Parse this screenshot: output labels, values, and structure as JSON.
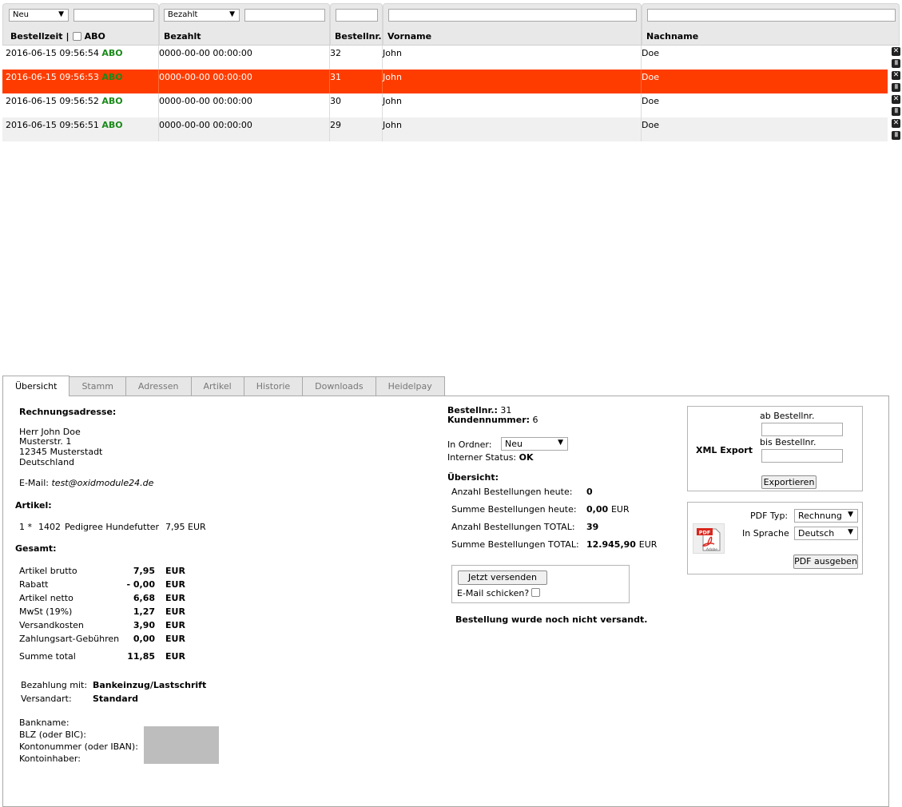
{
  "list": {
    "filters": {
      "folder_value": "Neu",
      "paid_value": "Bezahlt"
    },
    "headers": {
      "time": "Bestellzeit",
      "separator": "|",
      "abo": "ABO",
      "paid": "Bezahlt",
      "ordernr": "Bestellnr.",
      "firstname": "Vorname",
      "lastname": "Nachname"
    },
    "rows": [
      {
        "time": "2016-06-15 09:56:54",
        "abo": "ABO",
        "paid": "0000-00-00 00:00:00",
        "nr": "32",
        "first": "John",
        "last": "Doe"
      },
      {
        "time": "2016-06-15 09:56:53",
        "abo": "ABO",
        "paid": "0000-00-00 00:00:00",
        "nr": "31",
        "first": "John",
        "last": "Doe"
      },
      {
        "time": "2016-06-15 09:56:52",
        "abo": "ABO",
        "paid": "0000-00-00 00:00:00",
        "nr": "30",
        "first": "John",
        "last": "Doe"
      },
      {
        "time": "2016-06-15 09:56:51",
        "abo": "ABO",
        "paid": "0000-00-00 00:00:00",
        "nr": "29",
        "first": "John",
        "last": "Doe"
      }
    ],
    "selected_row_color": "#ff3c00",
    "abo_color": "#1a8a1a"
  },
  "tabs": [
    "Übersicht",
    "Stamm",
    "Adressen",
    "Artikel",
    "Historie",
    "Downloads",
    "Heidelpay"
  ],
  "overview": {
    "billing_heading": "Rechnungsadresse:",
    "address": [
      "Herr John Doe",
      "Musterstr. 1",
      "12345 Musterstadt",
      "Deutschland"
    ],
    "email_label": "E-Mail:",
    "email": "test@oxidmodule24.de",
    "articles_heading": "Artikel:",
    "article": {
      "qty": "1 *",
      "nr": "1402",
      "name": "Pedigree Hundefutter",
      "price": "7,95 EUR"
    },
    "total_heading": "Gesamt:",
    "totals": [
      {
        "label": "Artikel brutto",
        "value": "7,95",
        "cur": "EUR"
      },
      {
        "label": "Rabatt",
        "value": "- 0,00",
        "cur": "EUR"
      },
      {
        "label": "Artikel netto",
        "value": "6,68",
        "cur": "EUR"
      },
      {
        "label": "MwSt (19%)",
        "value": "1,27",
        "cur": "EUR"
      },
      {
        "label": "Versandkosten",
        "value": "3,90",
        "cur": "EUR"
      },
      {
        "label": "Zahlungsart-Gebühren",
        "value": "0,00",
        "cur": "EUR"
      }
    ],
    "sum": {
      "label": "Summe total",
      "value": "11,85",
      "cur": "EUR"
    },
    "payment_label": "Bezahlung mit:",
    "payment_value": "Bankeinzug/Lastschrift",
    "shipping_label": "Versandart:",
    "shipping_value": "Standard",
    "bank_labels": [
      "Bankname:",
      "BLZ (oder BIC):",
      "Kontonummer (oder IBAN):",
      "Kontoinhaber:"
    ],
    "order": {
      "nr_label": "Bestellnr.:",
      "nr": "31",
      "customer_label": "Kundennummer:",
      "customer": "6",
      "folder_label": "In Ordner:",
      "folder_value": "Neu",
      "status_label": "Interner Status:",
      "status": "OK"
    },
    "stats_heading": "Übersicht:",
    "stats": [
      {
        "label": "Anzahl Bestellungen heute:",
        "value": "0",
        "unit": ""
      },
      {
        "label": "Summe Bestellungen heute:",
        "value": "0,00",
        "unit": "EUR"
      },
      {
        "label": "Anzahl Bestellungen TOTAL:",
        "value": "39",
        "unit": ""
      },
      {
        "label": "Summe Bestellungen TOTAL:",
        "value": "12.945,90",
        "unit": "EUR"
      }
    ],
    "send_button": "Jetzt versenden",
    "send_mail_label": "E-Mail schicken?",
    "not_sent_msg": "Bestellung wurde noch nicht versandt."
  },
  "xml_export": {
    "title": "XML Export",
    "from_label": "ab Bestellnr.",
    "to_label": "bis Bestellnr.",
    "button": "Exportieren"
  },
  "pdf": {
    "icon_top": "PDF",
    "icon_bottom": "Adobe",
    "type_label": "PDF Typ:",
    "type_value": "Rechnung",
    "lang_label": "In Sprache",
    "lang_value": "Deutsch",
    "button": "PDF ausgeben"
  }
}
